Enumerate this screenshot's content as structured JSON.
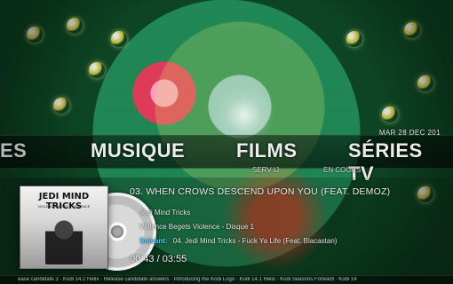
{
  "header": {
    "date": "MAR 28 DEC 201"
  },
  "menu": {
    "items": [
      {
        "label": "ES",
        "state": "dim"
      },
      {
        "label": "MUSIQUE",
        "state": "active"
      },
      {
        "label": "FILMS",
        "state": "normal"
      },
      {
        "label": "SÉRIES TV",
        "state": "normal"
      }
    ],
    "substatus": [
      {
        "label": "SERV IJ"
      },
      {
        "label": "EN COURS"
      }
    ]
  },
  "now_playing": {
    "cover": {
      "title": "JEDI MIND TRICKS",
      "subtitle": "VIOLENCE BEGETS VIOLENCE"
    },
    "track_title": "03. WHEN CROWS DESCEND UPON YOU (FEAT. DEMOZ)",
    "artist": "Jedi Mind Tricks",
    "album_line": "Violence Begets Violence - Disque 1",
    "next_label": "Suivant:",
    "next_text": "04. Jedi Mind Tricks - Fuck Ya Life (Feat. Blacastan)",
    "time": "00:43 / 03:55"
  },
  "ticker": {
    "text": "ease candidate 3 · Kodi 14.2 Helix · Release candidate answers · Introducing the Kodi Logo · Kodi 14.1 Helix · Kodi Seasons Forward · Kodi 14"
  },
  "colors": {
    "accent_blue": "#47c8ff"
  }
}
